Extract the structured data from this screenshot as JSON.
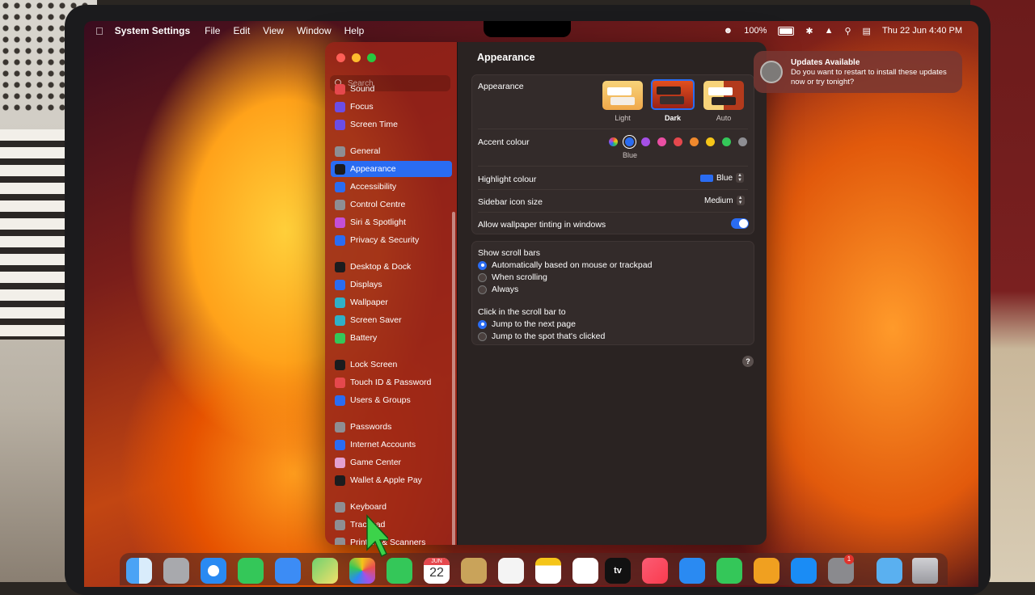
{
  "menubar": {
    "app_name": "System Settings",
    "menus": [
      "File",
      "Edit",
      "View",
      "Window",
      "Help"
    ],
    "battery": "100%",
    "datetime": "Thu 22 Jun  4:40 PM"
  },
  "search": {
    "placeholder": "Search"
  },
  "sidebar": {
    "items": [
      {
        "label": "Sound",
        "color": "#e5484d"
      },
      {
        "label": "Focus",
        "color": "#6b4de6"
      },
      {
        "label": "Screen Time",
        "color": "#6b4de6"
      },
      {
        "label": "General",
        "color": "#8e8e93"
      },
      {
        "label": "Appearance",
        "color": "#1c1c1e"
      },
      {
        "label": "Accessibility",
        "color": "#2a6cf2"
      },
      {
        "label": "Control Centre",
        "color": "#8e8e93"
      },
      {
        "label": "Siri & Spotlight",
        "color": "#c44fd6"
      },
      {
        "label": "Privacy & Security",
        "color": "#2a6cf2"
      },
      {
        "label": "Desktop & Dock",
        "color": "#1c1c1e"
      },
      {
        "label": "Displays",
        "color": "#2a6cf2"
      },
      {
        "label": "Wallpaper",
        "color": "#30b0c7"
      },
      {
        "label": "Screen Saver",
        "color": "#30b0c7"
      },
      {
        "label": "Battery",
        "color": "#34c759"
      },
      {
        "label": "Lock Screen",
        "color": "#1c1c1e"
      },
      {
        "label": "Touch ID & Password",
        "color": "#e5484d"
      },
      {
        "label": "Users & Groups",
        "color": "#2a6cf2"
      },
      {
        "label": "Passwords",
        "color": "#8e8e93"
      },
      {
        "label": "Internet Accounts",
        "color": "#2a6cf2"
      },
      {
        "label": "Game Center",
        "color": "#e3a0d0"
      },
      {
        "label": "Wallet & Apple Pay",
        "color": "#1c1c1e"
      },
      {
        "label": "Keyboard",
        "color": "#8e8e93"
      },
      {
        "label": "Trackpad",
        "color": "#8e8e93"
      },
      {
        "label": "Printers & Scanners",
        "color": "#8e8e93"
      }
    ],
    "active": "Appearance"
  },
  "content": {
    "title": "Appearance",
    "appearance_label": "Appearance",
    "modes": [
      "Light",
      "Dark",
      "Auto"
    ],
    "selected_mode": "Dark",
    "accent_label": "Accent colour",
    "accent_colors": [
      "multicolor",
      "#2a6cf2",
      "#a550e6",
      "#ea4fa3",
      "#e5484d",
      "#f0892d",
      "#f5c518",
      "#34c759",
      "#8e8e93"
    ],
    "accent_selected": "Blue",
    "highlight_label": "Highlight colour",
    "highlight_value": "Blue",
    "sidebar_icon_label": "Sidebar icon size",
    "sidebar_icon_value": "Medium",
    "tinting_label": "Allow wallpaper tinting in windows",
    "tinting_on": true,
    "scroll_label": "Show scroll bars",
    "scroll_options": [
      "Automatically based on mouse or trackpad",
      "When scrolling",
      "Always"
    ],
    "click_label": "Click in the scroll bar to",
    "click_options": [
      "Jump to the next page",
      "Jump to the spot that's clicked"
    ],
    "help": "?"
  },
  "notification": {
    "title": "Updates Available",
    "body": "Do you want to restart to install these updates now or try tonight?"
  },
  "dock": {
    "calendar_month": "JUN",
    "calendar_day": "22",
    "tv_label": "tv",
    "settings_badge": "1"
  }
}
